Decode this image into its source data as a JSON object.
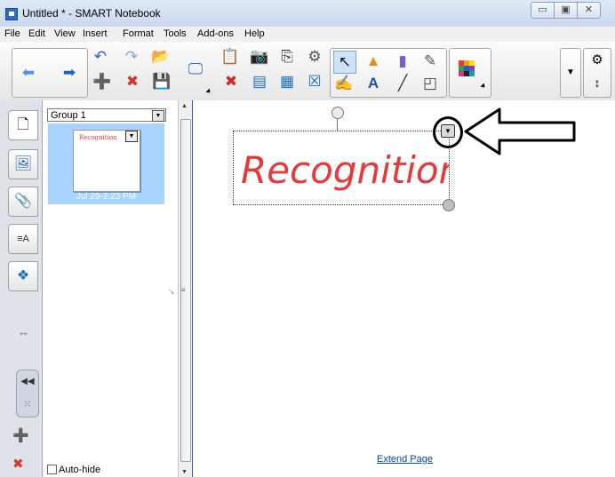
{
  "window": {
    "title": "Untitled * - SMART Notebook",
    "minimize_glyph": "▭",
    "maximize_glyph": "▣",
    "close_glyph": "✕"
  },
  "menu": [
    "File",
    "Edit",
    "View",
    "Insert",
    "Format",
    "Tools",
    "Add-ons",
    "Help"
  ],
  "side_panel": {
    "group_select_value": "Group 1",
    "thumbnail_label": "Jul 29-2:23 PM",
    "thumbnail_text": "Recognition",
    "autohide_label": "Auto-hide"
  },
  "canvas": {
    "ink_text": "Recognition",
    "extend_link": "Extend Page",
    "ink_color": "#e43a3a"
  },
  "toolbar_icons": [
    "back-arrow",
    "forward-arrow",
    "undo",
    "redo",
    "open-file",
    "add-page",
    "delete-page",
    "save",
    "screen-shade",
    "paste",
    "capture",
    "delete",
    "insert-table",
    "clone",
    "full-screen",
    "select",
    "shapes",
    "eraser",
    "magic-pen",
    "pens",
    "text",
    "line",
    "fill",
    "color-palette",
    "more-tools",
    "settings",
    "move-toolbar"
  ],
  "colors": {
    "title_bar": "#dfe9f5",
    "accent_blue": "#2d6bc7",
    "thumb_selected": "#a9d4ff"
  }
}
